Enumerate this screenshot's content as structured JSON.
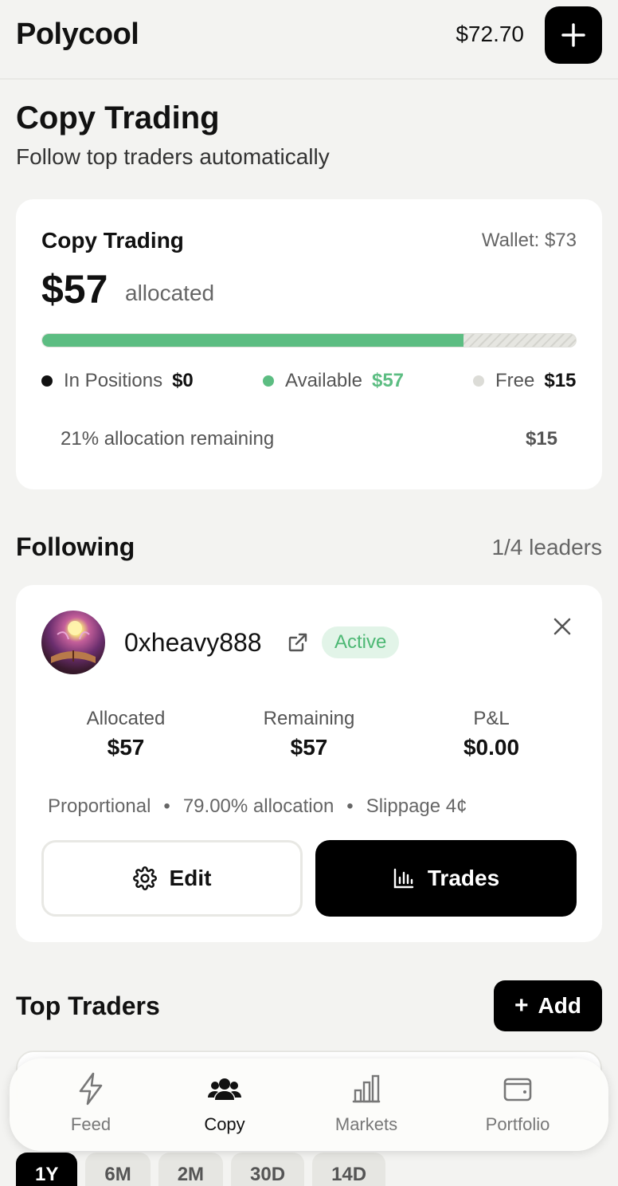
{
  "header": {
    "brand": "Polycool",
    "balance": "$72.70"
  },
  "page": {
    "title": "Copy Trading",
    "subtitle": "Follow top traders automatically"
  },
  "allocation": {
    "title": "Copy Trading",
    "wallet": "Wallet: $73",
    "amount": "$57",
    "amount_suffix": "allocated",
    "progress_fraction": 0.79,
    "legend": [
      {
        "label": "In Positions",
        "value": "$0",
        "color": "#111111"
      },
      {
        "label": "Available",
        "value": "$57",
        "color": "#5cbd82"
      },
      {
        "label": "Free",
        "value": "$15",
        "color": "#dcdcd7"
      }
    ],
    "remaining_text": "21% allocation remaining",
    "remaining_value": "$15"
  },
  "following": {
    "title": "Following",
    "count": "1/4 leaders",
    "leader": {
      "name": "0xheavy888",
      "status": "Active",
      "stats": [
        {
          "label": "Allocated",
          "value": "$57"
        },
        {
          "label": "Remaining",
          "value": "$57"
        },
        {
          "label": "P&L",
          "value": "$0.00"
        }
      ],
      "meta": [
        "Proportional",
        "79.00% allocation",
        "Slippage 4¢"
      ],
      "edit_label": "Edit",
      "trades_label": "Trades"
    }
  },
  "top_traders": {
    "title": "Top Traders",
    "add_label": "Add"
  },
  "tabs": [
    {
      "label": "Feed",
      "icon": "bolt-icon"
    },
    {
      "label": "Copy",
      "icon": "users-icon"
    },
    {
      "label": "Markets",
      "icon": "bar-chart-icon"
    },
    {
      "label": "Portfolio",
      "icon": "wallet-icon"
    }
  ],
  "active_tab": "Copy",
  "periods": [
    "1Y",
    "6M",
    "2M",
    "30D",
    "14D"
  ],
  "active_period": "1Y"
}
